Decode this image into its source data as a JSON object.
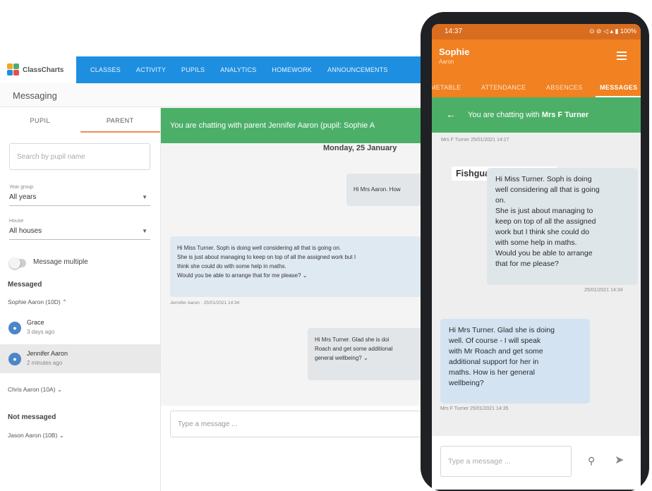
{
  "desktop": {
    "logo": "ClassCharts",
    "nav": [
      "CLASSES",
      "ACTIVITY",
      "PUPILS",
      "ANALYTICS",
      "HOMEWORK",
      "ANNOUNCEMENTS"
    ],
    "page_title": "Messaging",
    "tabs": [
      "PUPIL",
      "PARENT"
    ],
    "search_placeholder": "Search by pupil name",
    "year_group": {
      "label": "Year group",
      "value": "All years"
    },
    "house": {
      "label": "House",
      "value": "All houses"
    },
    "message_multiple": "Message multiple",
    "messaged_heading": "Messaged",
    "group1": "Sophie Aaron (10D)",
    "contacts": [
      {
        "name": "Grace",
        "time": "3 days ago"
      },
      {
        "name": "Jennifer Aaron",
        "time": "2 minutes ago"
      }
    ],
    "group2": "Chris Aaron (10A)",
    "not_messaged_heading": "Not messaged",
    "group3": "Jason Aaron (10B)",
    "banner": "You are chatting with parent Jennifer Aaron (pupil: Sophie A",
    "date": "Monday, 25 January",
    "msg1": "Hi Mrs Aaron. How",
    "msg2_lines": [
      "Hi Miss Turner. Soph is doing well considering all that is going on.",
      "She is just about managing to keep on top of all the assigned work but I",
      "think she could do with some help in maths.",
      "Would you be able to arrange that for me please?"
    ],
    "msg2_meta": "Jennifer Aaron  ·  25/01/2021 14:34",
    "msg3_lines": [
      "Hi Mrs Turner. Glad she is doi",
      "Roach and get some additional",
      "general wellbeing?"
    ],
    "composer_placeholder": "Type a message ..."
  },
  "phone": {
    "time": "14:37",
    "status_right": "⊙ ⊘ ◁ ▴ ▮ 100%",
    "name": "Sophie",
    "sub": "Aaron",
    "tabs": [
      "METABLE",
      "ATTENDANCE",
      "ABSENCES",
      "MESSAGES"
    ],
    "banner_prefix": "You are chatting with ",
    "banner_name": "Mrs F Turner",
    "top_meta": "Mrs F Turner   25/01/2021 14:27",
    "school": "Fishguard High School",
    "out_msg": [
      "Hi Miss Turner. Soph is doing",
      "well considering all that is going",
      "on.",
      "She is just about managing to",
      "keep on top of all the assigned",
      "work but I think she could do",
      "with some help in maths.",
      "Would you be able to arrange",
      "that for me please?"
    ],
    "out_meta": "25/01/2021 14:34",
    "in_msg": [
      "Hi Mrs Turner. Glad she is doing",
      "well. Of course - I will speak",
      "with Mr Roach and get some",
      "additional support for her in",
      "maths. How is her general",
      "wellbeing?"
    ],
    "in_meta": "Mrs F Turner   25/01/2021 14:35",
    "input_placeholder": "Type a message ..."
  },
  "colors": {
    "nav_blue": "#1e8fe0",
    "banner_green": "#4caf67",
    "phone_orange": "#f18121"
  }
}
